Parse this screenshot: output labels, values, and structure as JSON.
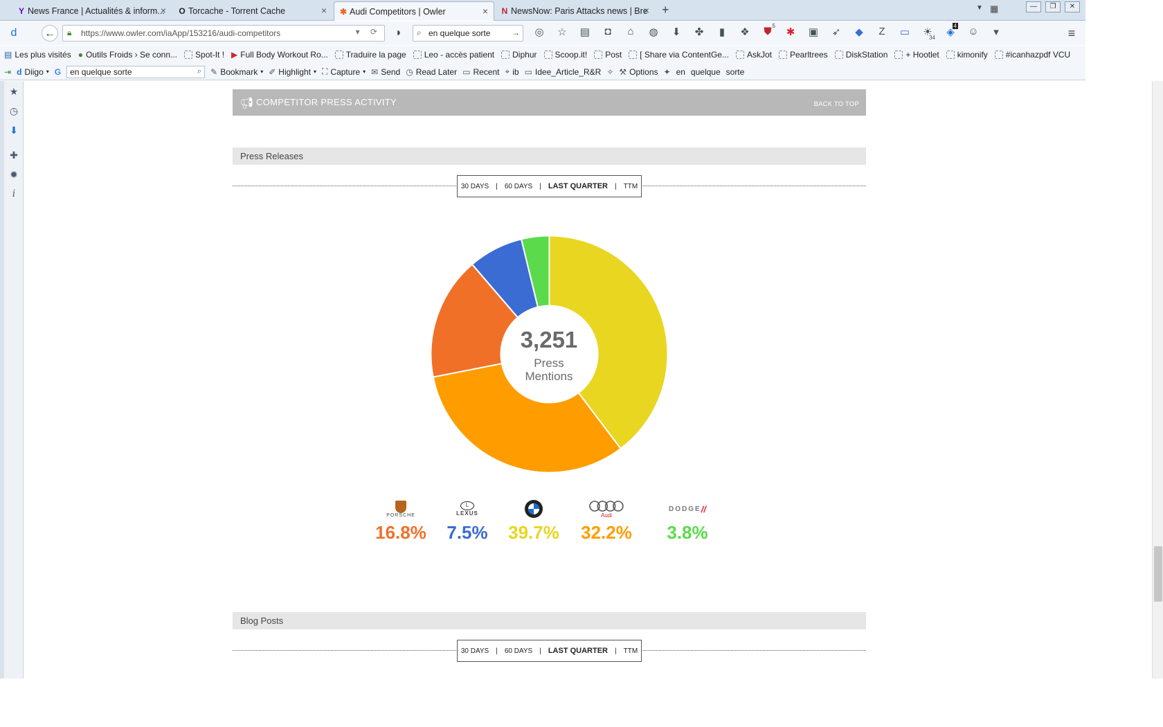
{
  "browser": {
    "tabs": [
      {
        "title": "News France | Actualités & inform...",
        "favicon": "Y",
        "active": false
      },
      {
        "title": "Torcache - Torrent Cache",
        "favicon": "O",
        "active": false
      },
      {
        "title": "Audi Competitors | Owler",
        "favicon": "✱",
        "active": true
      },
      {
        "title": "NewsNow: Paris Attacks news | Bre...",
        "favicon": "N",
        "active": false
      }
    ],
    "url": "https://www.owler.com/iaApp/153216/audi-competitors",
    "search_value": "en quelque sorte",
    "badges": {
      "ublock": "5",
      "counter_a": "34",
      "counter_b": "4"
    }
  },
  "bookmarks": [
    "Les plus visités",
    "Outils Froids › Se conn...",
    "Spot-It !",
    "Full Body Workout Ro...",
    "Traduire la page",
    "Leo - accès patient",
    "Diphur",
    "Scoop.it!",
    "Post",
    "[ Share via ContentGe...",
    "AskJot",
    "Pearltrees",
    "DiskStation",
    "+ Hootlet",
    "kimonify",
    "#icanhazpdf VCU"
  ],
  "diigo": {
    "brand": "Diigo",
    "search_value": "en quelque sorte",
    "items": [
      "Bookmark",
      "Highlight",
      "Capture",
      "Send",
      "Read Later",
      "Recent",
      "ib",
      "Idee_Article_R&R",
      "Options"
    ],
    "words": [
      "en",
      "quelque",
      "sorte"
    ]
  },
  "page": {
    "section_title": "COMPETITOR PRESS ACTIVITY",
    "back_to_top": "BACK TO TOP",
    "press_releases_label": "Press Releases",
    "blog_posts_label": "Blog Posts",
    "periods": [
      "30 DAYS",
      "60 DAYS",
      "LAST QUARTER",
      "TTM"
    ],
    "active_period": "LAST QUARTER",
    "total_mentions": "3,251",
    "total_label_1": "Press",
    "total_label_2": "Mentions"
  },
  "chart_data": {
    "type": "pie",
    "categories": [
      "Porsche",
      "Lexus",
      "BMW",
      "Audi",
      "Dodge"
    ],
    "values": [
      16.8,
      7.5,
      39.7,
      32.2,
      3.8
    ],
    "value_labels": [
      "16.8%",
      "7.5%",
      "39.7%",
      "32.2%",
      "3.8%"
    ],
    "logo_texts": [
      "PORSCHE",
      "LEXUS",
      "",
      "Audi",
      "DODGE"
    ],
    "colors": [
      "#f07028",
      "#3b6cd4",
      "#e8d621",
      "#ff9d00",
      "#5bdb4b"
    ],
    "draw_order": [
      2,
      3,
      0,
      1,
      4
    ]
  }
}
